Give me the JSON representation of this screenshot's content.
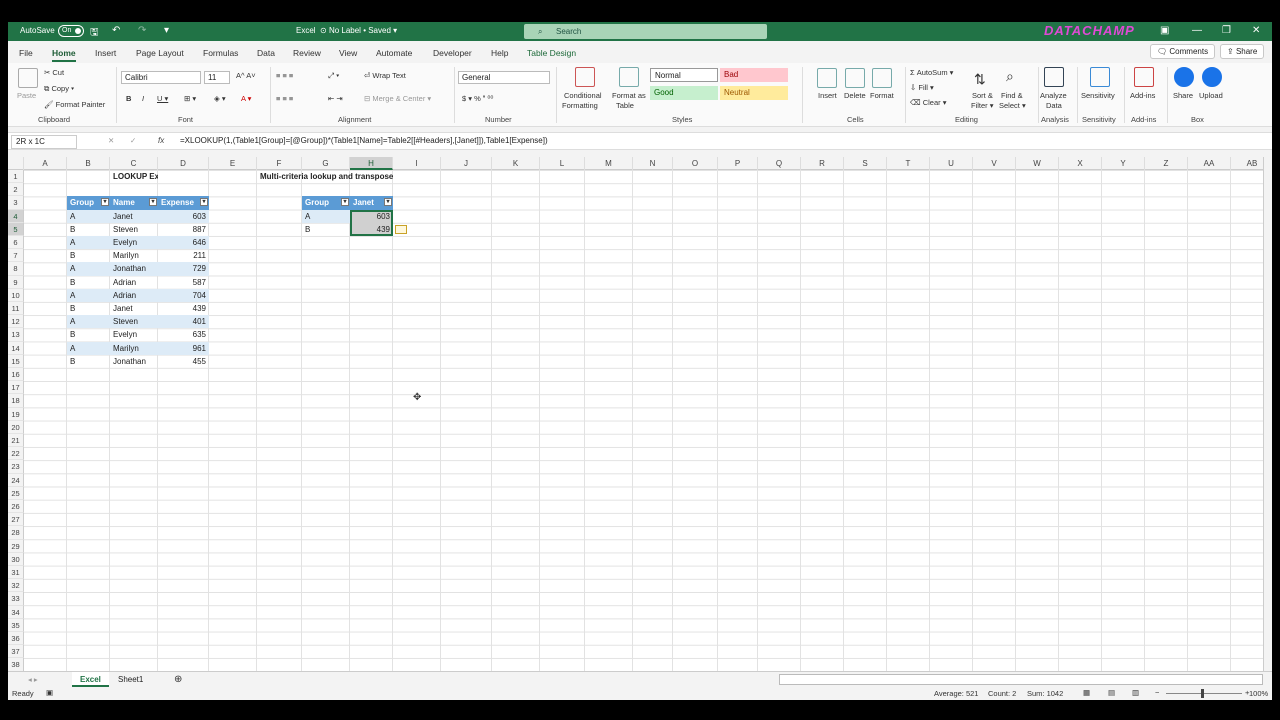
{
  "titlebar": {
    "autosave": "AutoSave",
    "toggle": "On",
    "doc": "Excel",
    "label": "No Label",
    "saved": "Saved",
    "search": "Search",
    "brand": "DATACHAMP"
  },
  "menu": [
    "File",
    "Home",
    "Insert",
    "Page Layout",
    "Formulas",
    "Data",
    "Review",
    "View",
    "Automate",
    "Developer",
    "Help",
    "Table Design"
  ],
  "buttons": {
    "comments": "Comments",
    "share": "Share"
  },
  "ribbon": {
    "clipboard": {
      "paste": "Paste",
      "cut": "Cut",
      "copy": "Copy",
      "painter": "Format Painter",
      "label": "Clipboard"
    },
    "font": {
      "name": "Calibri",
      "size": "11",
      "label": "Font"
    },
    "alignment": {
      "wrap": "Wrap Text",
      "merge": "Merge & Center",
      "label": "Alignment"
    },
    "number": {
      "format": "General",
      "label": "Number"
    },
    "styles": {
      "cond1": "Conditional",
      "cond2": "Formatting",
      "fmt1": "Format as",
      "fmt2": "Table",
      "normal": "Normal",
      "bad": "Bad",
      "good": "Good",
      "neutral": "Neutral",
      "label": "Styles"
    },
    "cells": {
      "insert": "Insert",
      "delete": "Delete",
      "format": "Format",
      "label": "Cells"
    },
    "editing": {
      "autosum": "AutoSum",
      "fill": "Fill",
      "clear": "Clear",
      "sort1": "Sort &",
      "sort2": "Filter",
      "find1": "Find &",
      "find2": "Select",
      "label": "Editing"
    },
    "analysis": {
      "btn1": "Analyze",
      "btn2": "Data",
      "label": "Analysis"
    },
    "sensitivity": {
      "btn": "Sensitivity",
      "label": "Sensitivity"
    },
    "addins": {
      "btn": "Add-ins",
      "label": "Add-ins"
    },
    "box": {
      "share": "Share",
      "upload": "Upload",
      "label": "Box"
    }
  },
  "formula": {
    "namebox": "2R x 1C",
    "fx": "fx",
    "text": "=XLOOKUP(1,(Table1[Group]=[@Group])*(Table1[Name]=Table2[[#Headers],[Janet]]),Table1[Expense])"
  },
  "columns": [
    "A",
    "B",
    "C",
    "D",
    "E",
    "F",
    "G",
    "H",
    "I",
    "J",
    "K",
    "L",
    "M",
    "N",
    "O",
    "P",
    "Q",
    "R",
    "S",
    "T",
    "U",
    "V",
    "W",
    "X",
    "Y",
    "Z",
    "AA",
    "AB"
  ],
  "rows": [
    "1",
    "2",
    "3",
    "4",
    "5",
    "6",
    "7",
    "8",
    "9",
    "10",
    "11",
    "12",
    "13",
    "14",
    "15",
    "16",
    "17",
    "18",
    "19",
    "20",
    "21",
    "22",
    "23",
    "24",
    "25",
    "26",
    "27",
    "28",
    "29",
    "30",
    "31",
    "32",
    "33",
    "34",
    "35",
    "36",
    "37",
    "38"
  ],
  "sheet": {
    "title1": "LOOKUP Excel Funtion",
    "title2": "Multi-criteria lookup and transpose",
    "t1_headers": [
      "Group",
      "Name",
      "Expense"
    ],
    "t1_rows": [
      [
        "A",
        "Janet",
        "603"
      ],
      [
        "B",
        "Steven",
        "887"
      ],
      [
        "A",
        "Evelyn",
        "646"
      ],
      [
        "B",
        "Marilyn",
        "211"
      ],
      [
        "A",
        "Jonathan",
        "729"
      ],
      [
        "B",
        "Adrian",
        "587"
      ],
      [
        "A",
        "Adrian",
        "704"
      ],
      [
        "B",
        "Janet",
        "439"
      ],
      [
        "A",
        "Steven",
        "401"
      ],
      [
        "B",
        "Evelyn",
        "635"
      ],
      [
        "A",
        "Marilyn",
        "961"
      ],
      [
        "B",
        "Jonathan",
        "455"
      ]
    ],
    "t2_headers": [
      "Group",
      "Janet"
    ],
    "t2_rows": [
      [
        "A",
        "603"
      ],
      [
        "B",
        "439"
      ]
    ]
  },
  "tabs": [
    "Excel",
    "Sheet1"
  ],
  "status": {
    "ready": "Ready",
    "average": "Average: 521",
    "count": "Count: 2",
    "sum": "Sum: 1042",
    "zoom": "100%"
  }
}
